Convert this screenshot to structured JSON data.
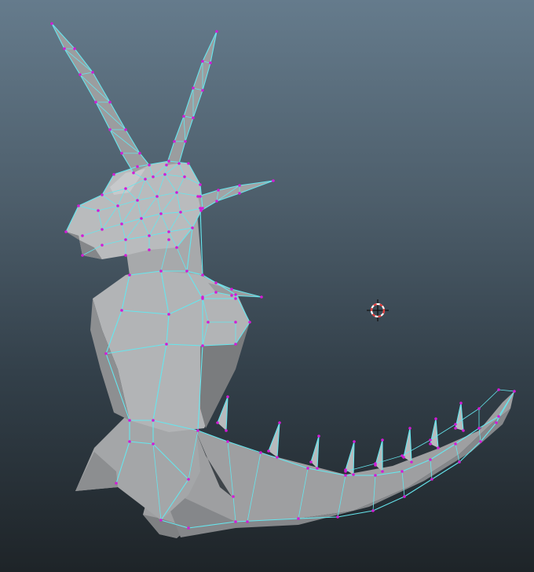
{
  "app": {
    "panel": "3d-viewport",
    "mode": "component-vertex"
  },
  "viewport": {
    "background_top": "#657b8c",
    "background_bottom": "#1e2428",
    "selection_edge_color": "#66e6ee",
    "vertex_color": "#d21bd6",
    "mesh_color": "#a9abac"
  },
  "model": {
    "shape": "low-poly-creature-with-horns-and-spiked-tail"
  },
  "pivot": {
    "icon": "crosshair-manipulator-icon",
    "color": "#e23b3b"
  }
}
